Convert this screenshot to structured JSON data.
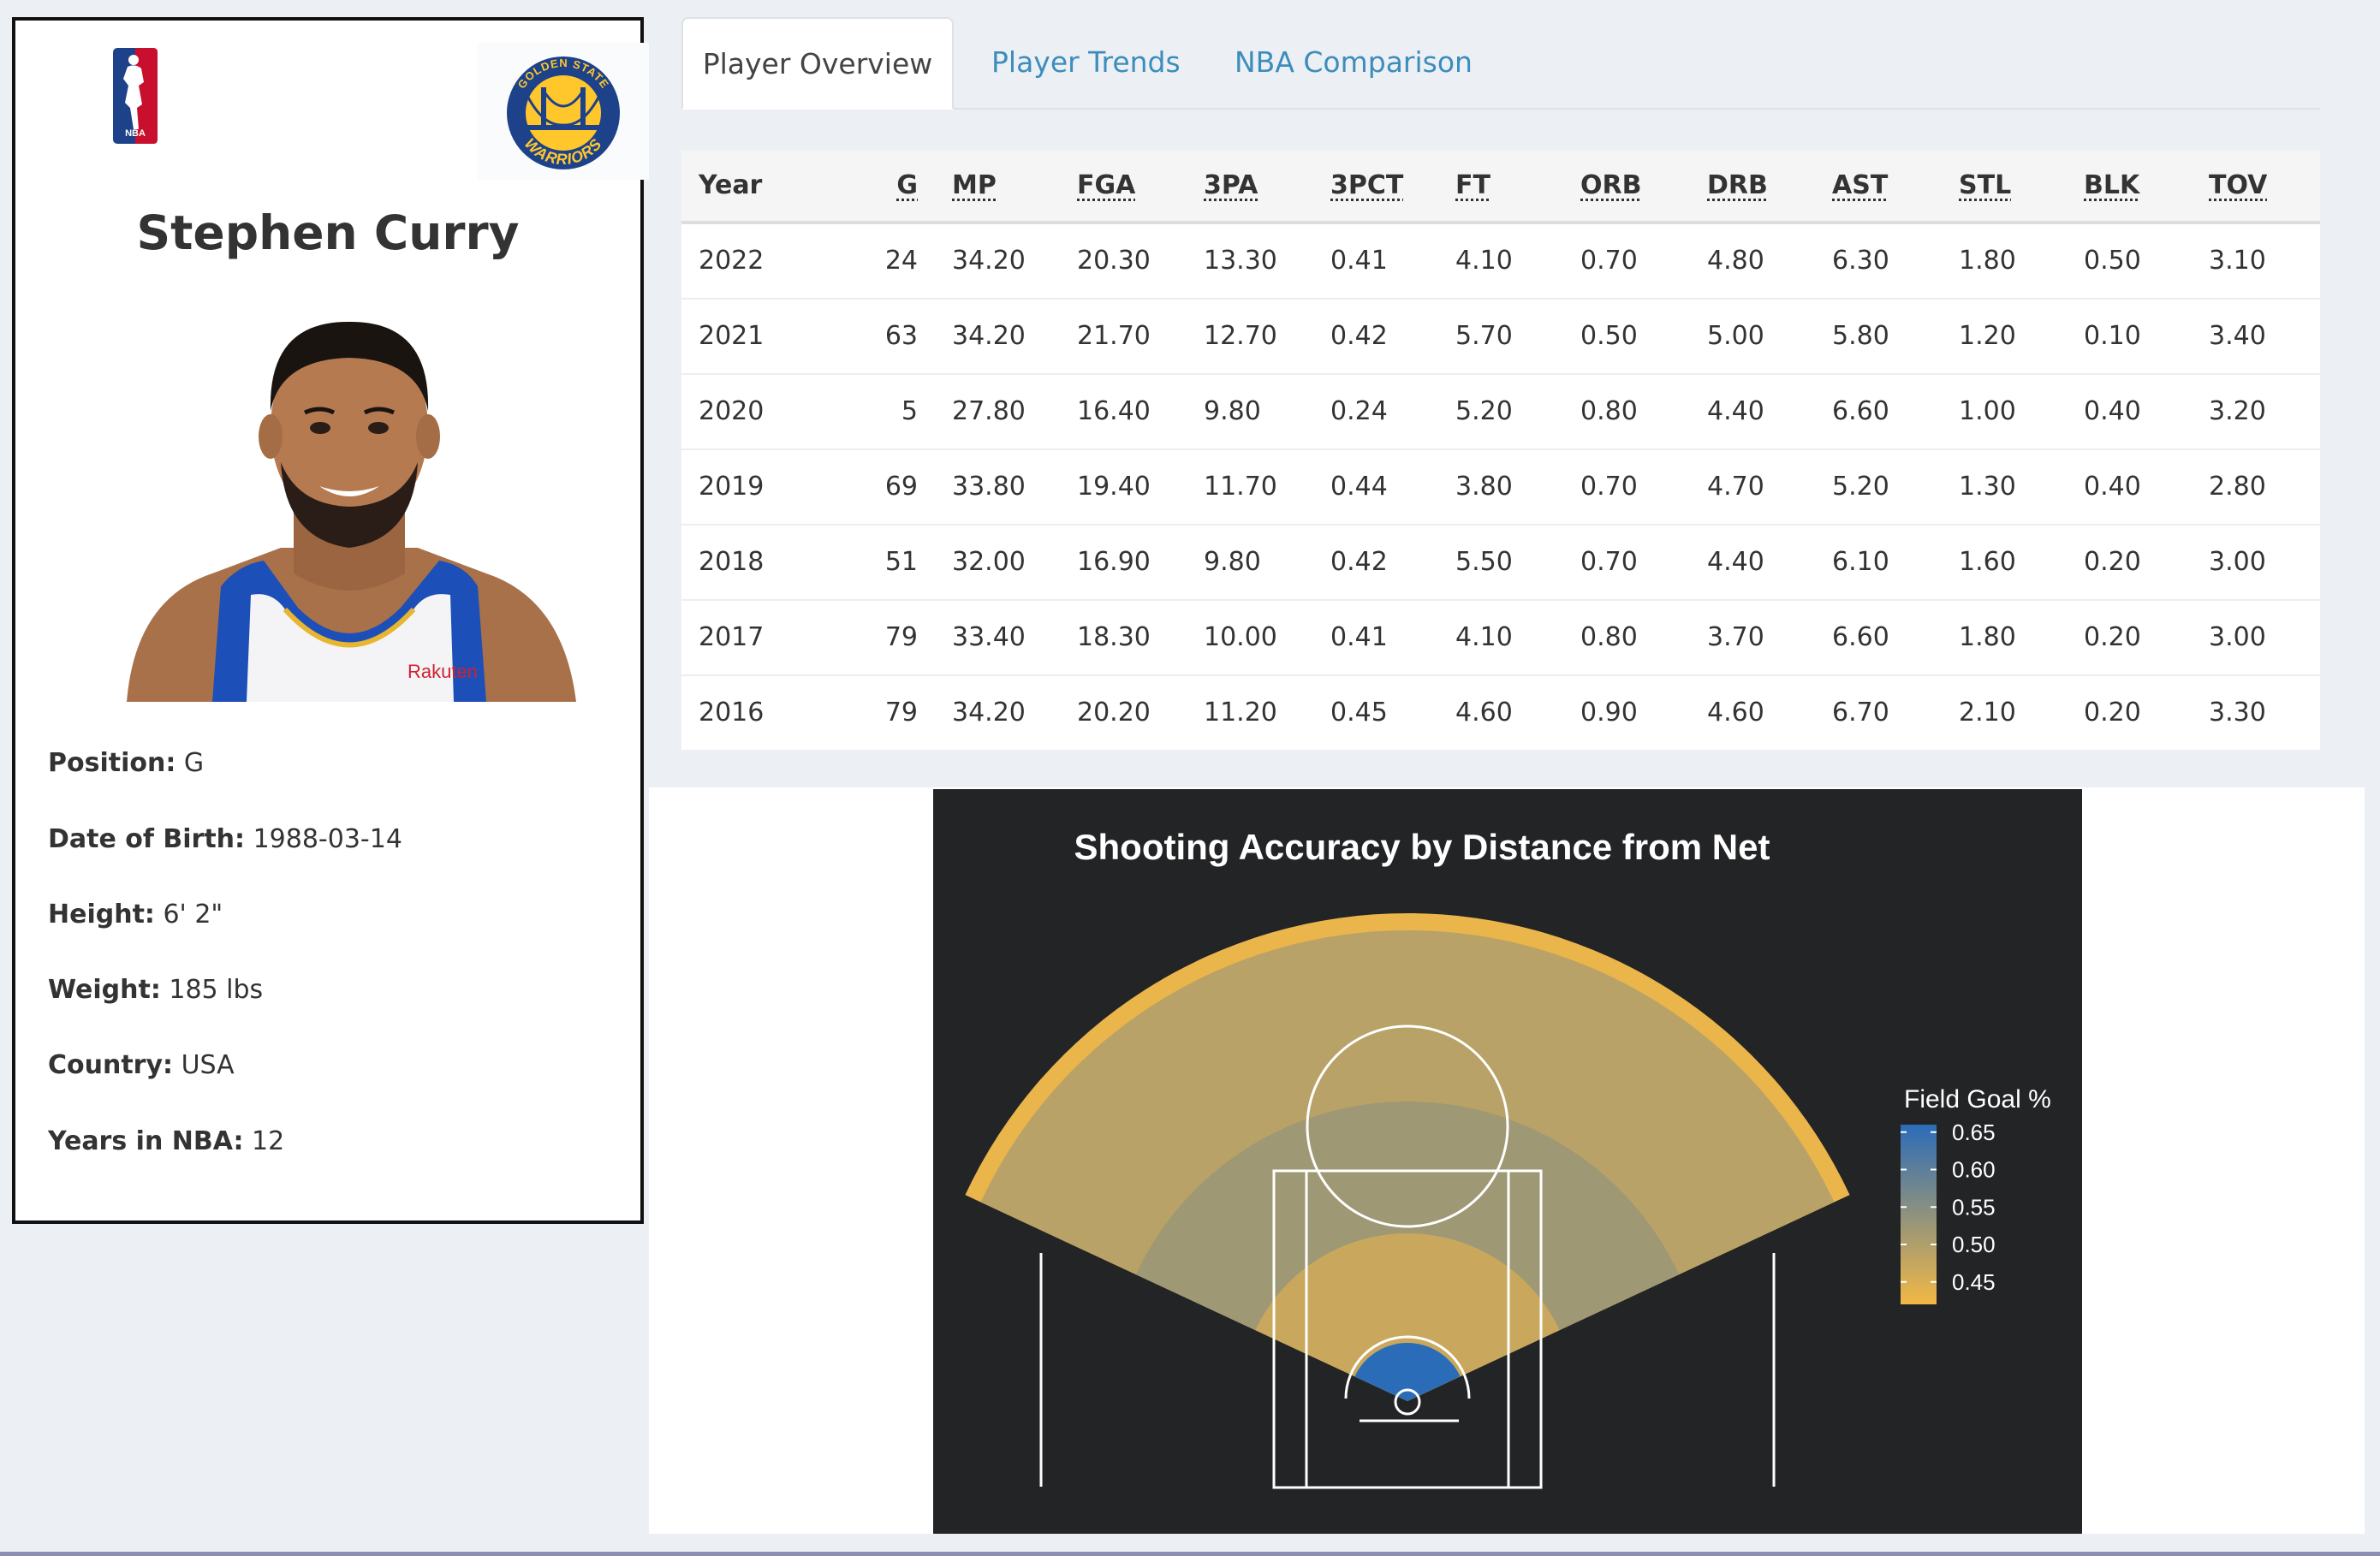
{
  "player": {
    "name": "Stephen Curry",
    "nba_logo_icon": "nba-logo",
    "team_logo_icon": "golden-state-warriors-logo",
    "team_logo_text_top": "GOLDEN STATE",
    "team_logo_text_bottom": "WARRIORS",
    "jersey_text": "Rakuten",
    "attributes": [
      {
        "label": "Position:",
        "value": " G"
      },
      {
        "label": "Date of Birth:",
        "value": " 1988-03-14"
      },
      {
        "label": "Height:",
        "value": " 6' 2\""
      },
      {
        "label": "Weight:",
        "value": " 185 lbs"
      },
      {
        "label": "Country:",
        "value": " USA"
      },
      {
        "label": "Years in NBA:",
        "value": " 12"
      }
    ]
  },
  "tabs": [
    {
      "label": "Player Overview",
      "active": true
    },
    {
      "label": "Player Trends",
      "active": false
    },
    {
      "label": "NBA Comparison",
      "active": false
    }
  ],
  "table": {
    "columns": [
      "Year",
      "G",
      "MP",
      "FGA",
      "3PA",
      "3PCT",
      "FT",
      "ORB",
      "DRB",
      "AST",
      "STL",
      "BLK",
      "TOV"
    ],
    "rows": [
      [
        "2022",
        "24",
        "34.20",
        "20.30",
        "13.30",
        "0.41",
        "4.10",
        "0.70",
        "4.80",
        "6.30",
        "1.80",
        "0.50",
        "3.10"
      ],
      [
        "2021",
        "63",
        "34.20",
        "21.70",
        "12.70",
        "0.42",
        "5.70",
        "0.50",
        "5.00",
        "5.80",
        "1.20",
        "0.10",
        "3.40"
      ],
      [
        "2020",
        "5",
        "27.80",
        "16.40",
        "9.80",
        "0.24",
        "5.20",
        "0.80",
        "4.40",
        "6.60",
        "1.00",
        "0.40",
        "3.20"
      ],
      [
        "2019",
        "69",
        "33.80",
        "19.40",
        "11.70",
        "0.44",
        "3.80",
        "0.70",
        "4.70",
        "5.20",
        "1.30",
        "0.40",
        "2.80"
      ],
      [
        "2018",
        "51",
        "32.00",
        "16.90",
        "9.80",
        "0.42",
        "5.50",
        "0.70",
        "4.40",
        "6.10",
        "1.60",
        "0.20",
        "3.00"
      ],
      [
        "2017",
        "79",
        "33.40",
        "18.30",
        "10.00",
        "0.41",
        "4.10",
        "0.80",
        "3.70",
        "6.60",
        "1.80",
        "0.20",
        "3.00"
      ],
      [
        "2016",
        "79",
        "34.20",
        "20.20",
        "11.20",
        "0.45",
        "4.60",
        "0.90",
        "4.60",
        "6.70",
        "2.10",
        "0.20",
        "3.30"
      ]
    ]
  },
  "chart_data": {
    "type": "heatmap",
    "title": "Shooting Accuracy by Distance from Net",
    "legend_title": "Field Goal %",
    "legend_ticks": [
      "0.65",
      "0.60",
      "0.55",
      "0.50",
      "0.45"
    ],
    "colorscale": {
      "min": 0.42,
      "max": 0.66,
      "low_color": "#f2b845",
      "high_color": "#2b6cb8"
    },
    "zones": [
      {
        "zone": "restricted area",
        "fg_pct": 0.66
      },
      {
        "zone": "short mid-range",
        "fg_pct": 0.47
      },
      {
        "zone": "long mid-range",
        "fg_pct": 0.52
      },
      {
        "zone": "three-point range",
        "fg_pct": 0.49
      },
      {
        "zone": "beyond three-point line",
        "fg_pct": 0.43
      }
    ],
    "legend_position": "right",
    "background": "#232425"
  }
}
